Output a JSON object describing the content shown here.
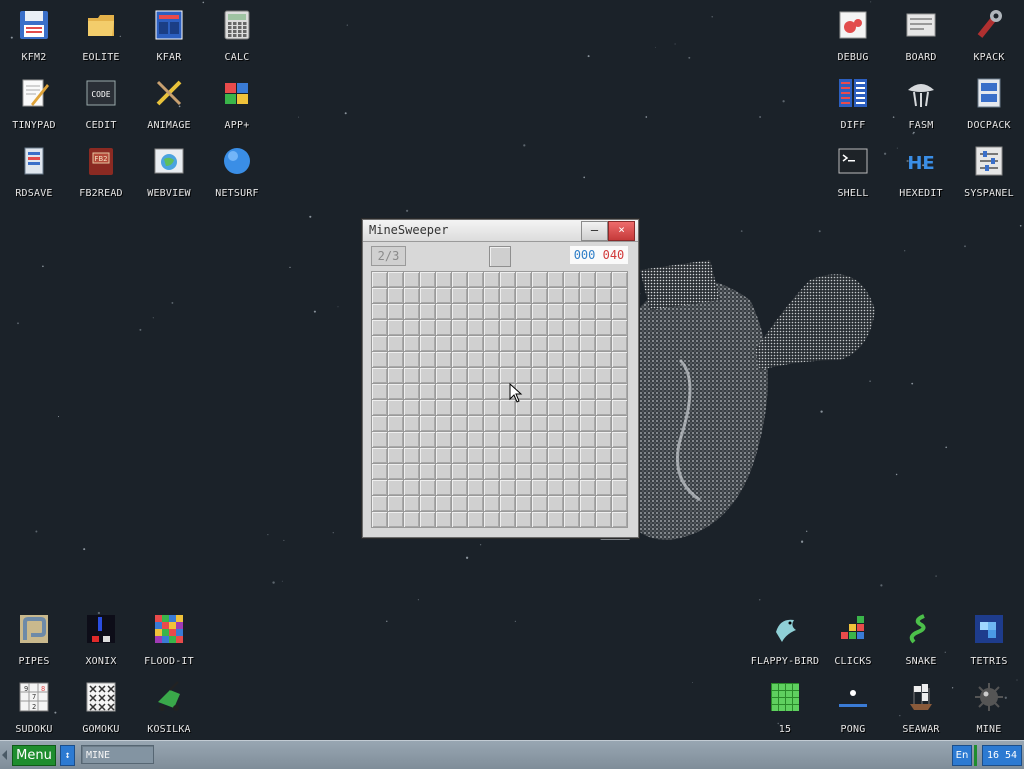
{
  "desktop": {
    "icons_top_left": [
      "KFM2",
      "EOLITE",
      "KFAR",
      "CALC",
      "TINYPAD",
      "CEDIT",
      "ANIMAGE",
      "APP+",
      "RDSAVE",
      "FB2READ",
      "WEBVIEW",
      "NETSURF"
    ],
    "icons_top_right": [
      "DEBUG",
      "BOARD",
      "KPACK",
      "DIFF",
      "FASM",
      "DOCPACK",
      "SHELL",
      "HEXEDIT",
      "SYSPANEL"
    ],
    "icons_bottom_left": [
      "PIPES",
      "XONIX",
      "FLOOD-IT",
      "SUDOKU",
      "GOMOKU",
      "KOSILKA"
    ],
    "icons_bottom_right": [
      "FLAPPY-BIRD",
      "CLICKS",
      "SNAKE",
      "TETRIS",
      "15",
      "PONG",
      "SEAWAR",
      "MINE"
    ],
    "icon_glyphs": {
      "CEDIT": "CODE",
      "FB2READ": "FB2",
      "HEXEDIT": "HE",
      "SUDOKU": [
        "9",
        "7",
        "8",
        "2"
      ]
    }
  },
  "window": {
    "title": "MineSweeper",
    "minimize_symbol": "–",
    "close_symbol": "×",
    "level": "2/3",
    "time": "000",
    "mines_left": "040",
    "grid": {
      "rows": 16,
      "cols": 16
    }
  },
  "taskbar": {
    "menu_label": "Menu",
    "switch_symbol": "↕",
    "active_task": "MINE",
    "language": "En",
    "clock": "16 54"
  },
  "colors": {
    "desktop_bg": "#1b2229",
    "menu_green": "#1e8d2e",
    "accent_blue": "#2c7ad2",
    "close_red": "#d9534f",
    "time_blue": "#2f7fc8",
    "mines_red": "#d23a3a"
  }
}
